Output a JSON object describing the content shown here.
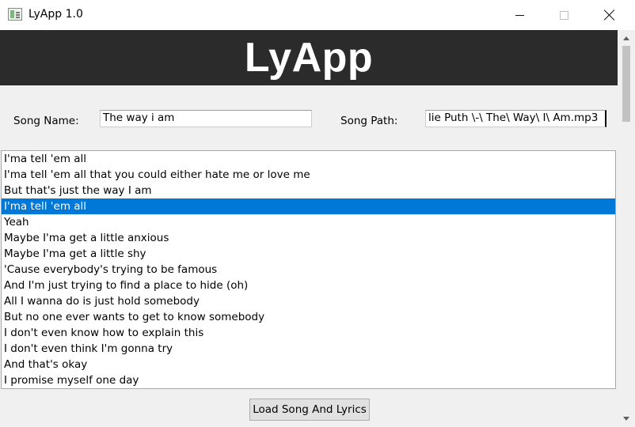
{
  "window": {
    "title": "LyApp 1.0"
  },
  "header": {
    "title": "LyApp",
    "background": "#2b2b2b"
  },
  "form": {
    "song_name_label": "Song Name:",
    "song_name_value": "The way i am",
    "song_path_label": "Song Path:",
    "song_path_value": "lie Puth \\-\\ The\\ Way\\ I\\ Am.mp3"
  },
  "lyrics": {
    "selected_index": 3,
    "selected_color": "#0078d7",
    "lines": [
      "I'ma tell 'em all",
      "I'ma tell 'em all that you could either hate me or love me",
      "But that's just the way I am",
      "I'ma tell 'em all",
      "Yeah",
      "Maybe I'ma get a little anxious",
      "Maybe I'ma get a little shy",
      "'Cause everybody's trying to be famous",
      "And I'm just trying to find a place to hide (oh)",
      "All I wanna do is just hold somebody",
      "But no one ever wants to get to know somebody",
      "I don't even know how to explain this",
      "I don't even think I'm gonna try",
      "And that's okay",
      "I promise myself one day"
    ]
  },
  "actions": {
    "load_label": "Load Song And Lyrics"
  },
  "icons": {
    "app": "app-icon",
    "minimize": "minimize-icon",
    "maximize": "maximize-icon",
    "close": "close-icon",
    "scroll_up": "scroll-up-icon",
    "scroll_down": "scroll-down-icon"
  }
}
